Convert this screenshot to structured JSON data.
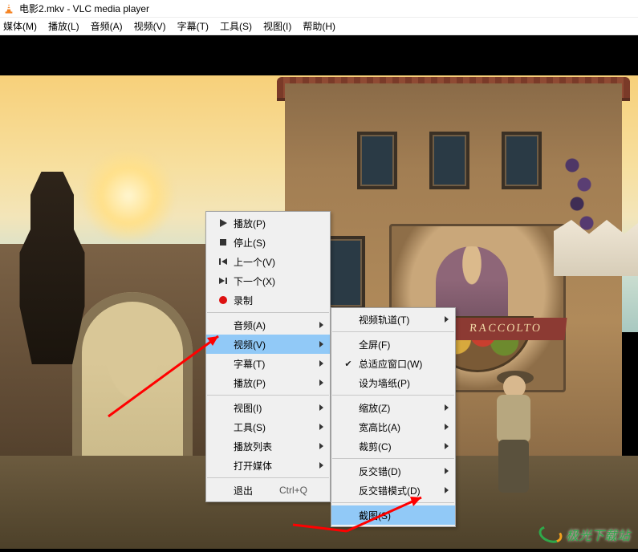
{
  "titlebar": {
    "text": "电影2.mkv - VLC media player"
  },
  "menubar": {
    "items": [
      "媒体(M)",
      "播放(L)",
      "音频(A)",
      "视频(V)",
      "字幕(T)",
      "工具(S)",
      "视图(I)",
      "帮助(H)"
    ]
  },
  "scene": {
    "banner_text": "RACCOLTO"
  },
  "context_menu": {
    "items": [
      {
        "icon": "play",
        "label": "播放(P)",
        "submenu": false
      },
      {
        "icon": "stop",
        "label": "停止(S)",
        "submenu": false
      },
      {
        "icon": "prev",
        "label": "上一个(V)",
        "submenu": false
      },
      {
        "icon": "next",
        "label": "下一个(X)",
        "submenu": false
      },
      {
        "icon": "rec",
        "label": "录制",
        "submenu": false
      },
      {
        "sep": true
      },
      {
        "label": "音频(A)",
        "submenu": true
      },
      {
        "label": "视频(V)",
        "submenu": true,
        "hover": true
      },
      {
        "label": "字幕(T)",
        "submenu": true
      },
      {
        "label": "播放(P)",
        "submenu": true
      },
      {
        "sep": true
      },
      {
        "label": "视图(I)",
        "submenu": true
      },
      {
        "label": "工具(S)",
        "submenu": true
      },
      {
        "label": "播放列表",
        "submenu": true
      },
      {
        "label": "打开媒体",
        "submenu": true
      },
      {
        "sep": true
      },
      {
        "label": "退出",
        "shortcut": "Ctrl+Q",
        "submenu": false
      }
    ]
  },
  "submenu_video": {
    "items": [
      {
        "label": "视频轨道(T)",
        "submenu": true
      },
      {
        "sep": true
      },
      {
        "label": "全屏(F)"
      },
      {
        "label": "总适应窗口(W)",
        "checked": true
      },
      {
        "label": "设为墙纸(P)"
      },
      {
        "sep": true
      },
      {
        "label": "缩放(Z)",
        "submenu": true
      },
      {
        "label": "宽高比(A)",
        "submenu": true
      },
      {
        "label": "裁剪(C)",
        "submenu": true
      },
      {
        "sep": true
      },
      {
        "label": "反交错(D)",
        "submenu": true
      },
      {
        "label": "反交错模式(D)",
        "submenu": true
      },
      {
        "sep": true
      },
      {
        "label": "截图(S)",
        "hover": true
      }
    ]
  },
  "watermark": {
    "text": "极光下载站"
  }
}
